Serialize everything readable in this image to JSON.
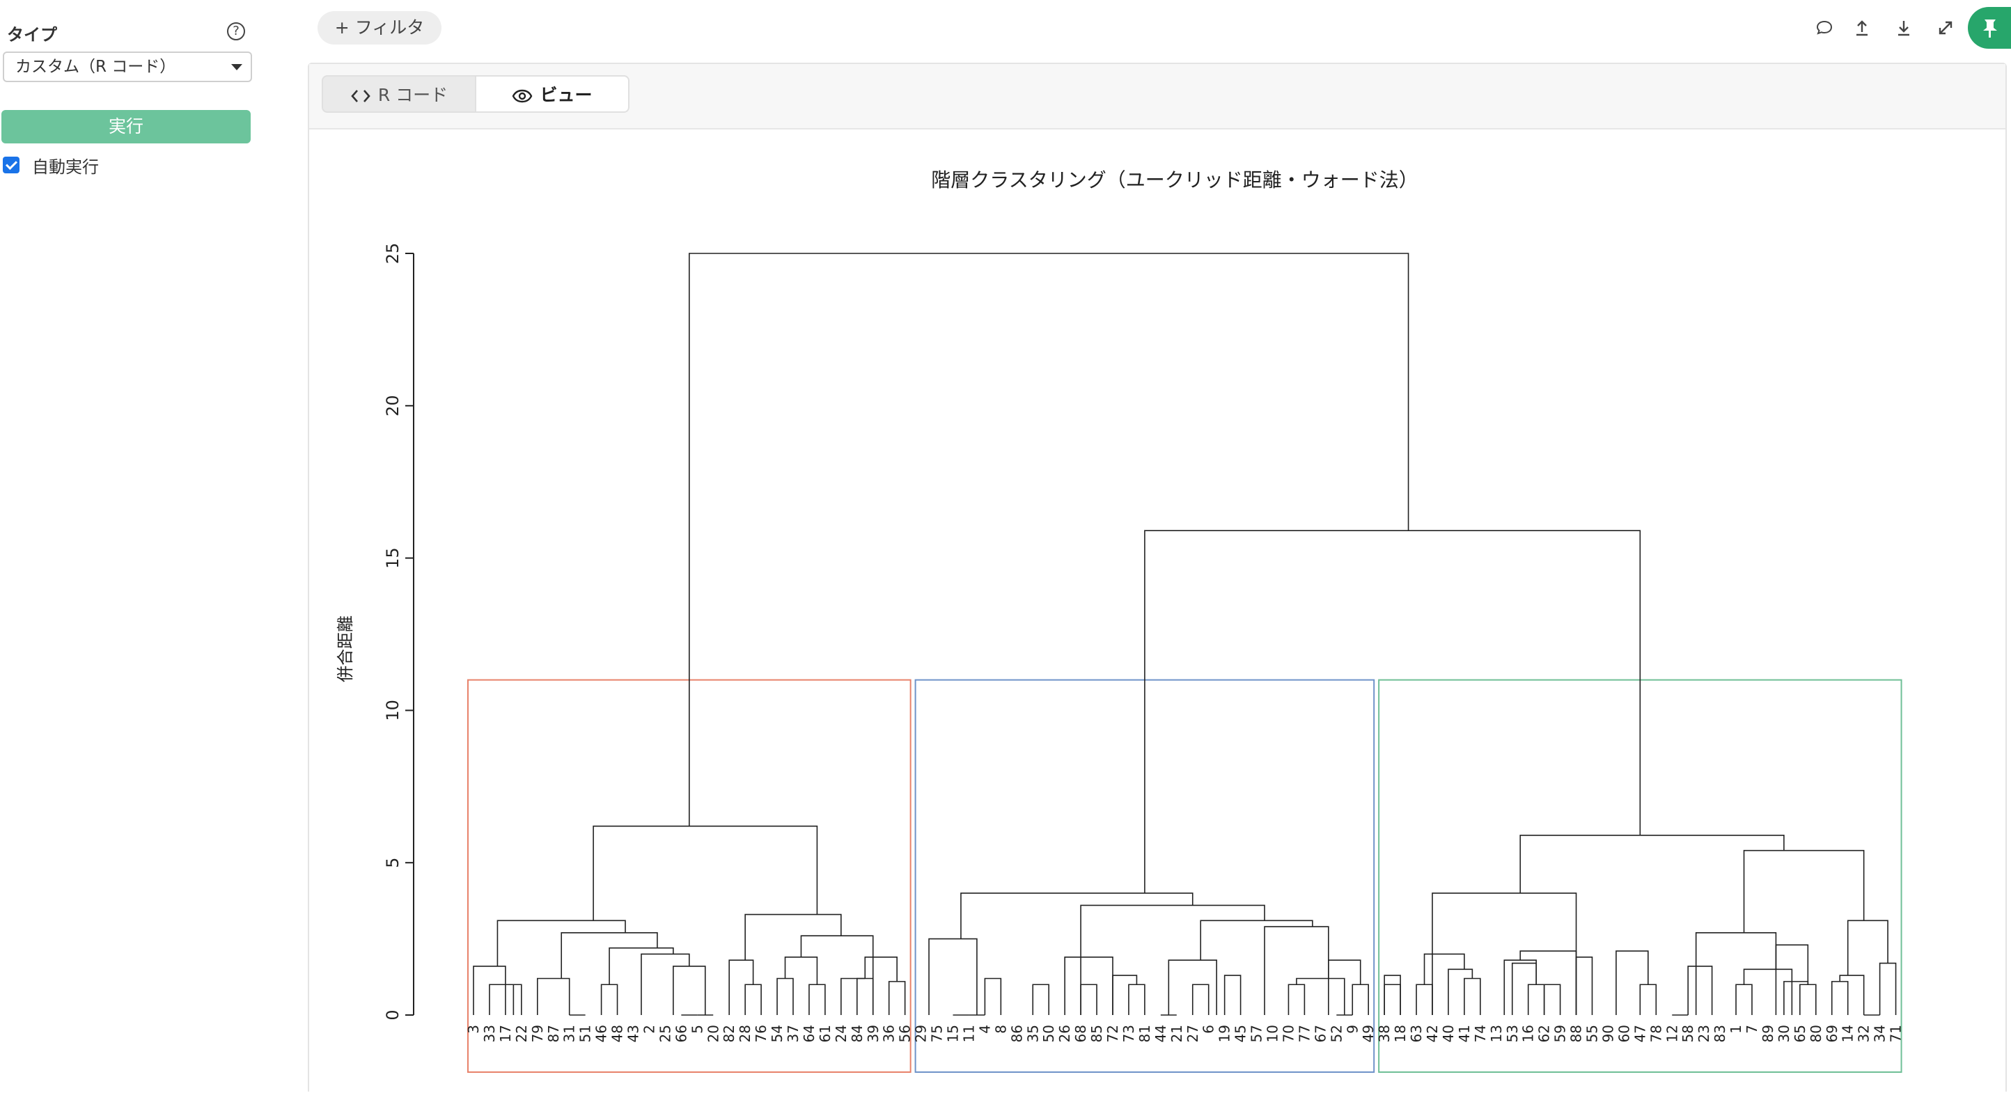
{
  "sidebar": {
    "type_label": "タイプ",
    "select_value": "カスタム（R コード）",
    "run_label": "実行",
    "auto_run_label": "自動実行",
    "auto_run_checked": true
  },
  "toolbar": {
    "filter_label": "+ フィルタ",
    "icons": [
      "comment-icon",
      "upload-icon",
      "download-icon",
      "expand-icon",
      "pin-icon"
    ],
    "accent_color": "#27a66b"
  },
  "tabs": {
    "code_label": "R コード",
    "view_label": "ビュー",
    "active": "view"
  },
  "chart_data": {
    "type": "dendrogram",
    "title": "階層クラスタリング（ユークリッド距離・ウォード法）",
    "ylabel": "併合距離",
    "ylim": [
      0,
      25
    ],
    "yticks": [
      0,
      5,
      10,
      15,
      20,
      25
    ],
    "leaves": [
      "3",
      "33",
      "17",
      "22",
      "79",
      "87",
      "31",
      "51",
      "46",
      "48",
      "43",
      "2",
      "25",
      "66",
      "5",
      "20",
      "82",
      "28",
      "76",
      "54",
      "37",
      "64",
      "61",
      "24",
      "84",
      "39",
      "36",
      "56",
      "29",
      "75",
      "15",
      "11",
      "4",
      "8",
      "86",
      "35",
      "50",
      "26",
      "68",
      "85",
      "72",
      "73",
      "81",
      "44",
      "21",
      "27",
      "6",
      "19",
      "45",
      "57",
      "10",
      "70",
      "77",
      "67",
      "52",
      "9",
      "49",
      "38",
      "18",
      "63",
      "42",
      "40",
      "41",
      "74",
      "13",
      "53",
      "16",
      "62",
      "59",
      "88",
      "55",
      "90",
      "60",
      "47",
      "78",
      "12",
      "58",
      "23",
      "83",
      "1",
      "7",
      "89",
      "30",
      "65",
      "80",
      "69",
      "14",
      "32",
      "34",
      "71"
    ],
    "merges": [
      {
        "height": 25.0,
        "ranges": [
          [
            0,
            27
          ],
          [
            28,
            89
          ]
        ]
      },
      {
        "height": 15.9,
        "ranges": [
          [
            28,
            56
          ],
          [
            57,
            89
          ]
        ]
      },
      {
        "height": 6.2,
        "ranges": [
          [
            0,
            15
          ],
          [
            16,
            27
          ]
        ]
      },
      {
        "height": 5.9,
        "ranges": [
          [
            57,
            74
          ],
          [
            75,
            89
          ]
        ]
      },
      {
        "height": 5.4,
        "ranges": [
          [
            75,
            84
          ],
          [
            85,
            89
          ]
        ]
      },
      {
        "height": 4.0,
        "ranges": [
          [
            28,
            33
          ],
          [
            34,
            56
          ]
        ]
      },
      {
        "height": 4.0,
        "ranges": [
          [
            57,
            63
          ],
          [
            64,
            74
          ]
        ]
      },
      {
        "height": 3.6,
        "ranges": [
          [
            34,
            42
          ],
          [
            43,
            56
          ]
        ]
      },
      {
        "height": 3.3,
        "ranges": [
          [
            16,
            18
          ],
          [
            19,
            27
          ]
        ]
      },
      {
        "height": 3.1,
        "ranges": [
          [
            0,
            3
          ],
          [
            4,
            15
          ]
        ]
      },
      {
        "height": 3.1,
        "ranges": [
          [
            43,
            48
          ],
          [
            49,
            56
          ]
        ]
      },
      {
        "height": 3.1,
        "ranges": [
          [
            85,
            87
          ],
          [
            88,
            89
          ]
        ]
      },
      {
        "height": 2.9,
        "ranges": [
          [
            49,
            50
          ],
          [
            51,
            56
          ]
        ]
      },
      {
        "height": 2.7,
        "ranges": [
          [
            4,
            7
          ],
          [
            8,
            15
          ]
        ]
      },
      {
        "height": 2.7,
        "ranges": [
          [
            75,
            78
          ],
          [
            79,
            84
          ]
        ]
      },
      {
        "height": 2.6,
        "ranges": [
          [
            19,
            22
          ],
          [
            23,
            27
          ]
        ]
      },
      {
        "height": 2.5,
        "ranges": [
          [
            28,
            29
          ],
          [
            30,
            33
          ]
        ]
      },
      {
        "height": 2.3,
        "ranges": [
          [
            81,
            82
          ],
          [
            83,
            84
          ]
        ]
      },
      {
        "height": 2.2,
        "ranges": [
          [
            8,
            9
          ],
          [
            10,
            15
          ]
        ]
      },
      {
        "height": 2.1,
        "ranges": [
          [
            64,
            67
          ],
          [
            68,
            70
          ]
        ]
      },
      {
        "height": 2.1,
        "ranges": [
          [
            71,
            72
          ],
          [
            73,
            74
          ]
        ]
      },
      {
        "height": 2.0,
        "ranges": [
          [
            59,
            60
          ],
          [
            61,
            63
          ]
        ]
      },
      {
        "height": 2.0,
        "ranges": [
          [
            10,
            11
          ],
          [
            12,
            15
          ]
        ]
      },
      {
        "height": 1.9,
        "ranges": [
          [
            19,
            20
          ],
          [
            21,
            22
          ]
        ]
      },
      {
        "height": 1.9,
        "ranges": [
          [
            24,
            25
          ],
          [
            26,
            27
          ]
        ]
      },
      {
        "height": 1.9,
        "ranges": [
          [
            37,
            37
          ],
          [
            38,
            42
          ]
        ]
      },
      {
        "height": 1.9,
        "ranges": [
          [
            69,
            69
          ],
          [
            70,
            70
          ]
        ]
      },
      {
        "height": 1.8,
        "ranges": [
          [
            43,
            44
          ],
          [
            45,
            48
          ]
        ]
      },
      {
        "height": 1.8,
        "ranges": [
          [
            64,
            65
          ],
          [
            66,
            67
          ]
        ]
      },
      {
        "height": 1.8,
        "ranges": [
          [
            16,
            16
          ],
          [
            17,
            18
          ]
        ]
      },
      {
        "height": 1.8,
        "ranges": [
          [
            53,
            54
          ],
          [
            55,
            56
          ]
        ]
      },
      {
        "height": 1.7,
        "ranges": [
          [
            65,
            65
          ],
          [
            66,
            67
          ]
        ]
      },
      {
        "height": 1.7,
        "ranges": [
          [
            89,
            89
          ],
          [
            88,
            88
          ]
        ]
      },
      {
        "height": 1.6,
        "ranges": [
          [
            0,
            0
          ],
          [
            1,
            3
          ]
        ]
      },
      {
        "height": 1.6,
        "ranges": [
          [
            12,
            13
          ],
          [
            14,
            15
          ]
        ]
      },
      {
        "height": 1.6,
        "ranges": [
          [
            77,
            78
          ],
          [
            76,
            76
          ]
        ]
      },
      {
        "height": 1.5,
        "ranges": [
          [
            79,
            80
          ],
          [
            81,
            84
          ]
        ]
      },
      {
        "height": 1.5,
        "ranges": [
          [
            61,
            61
          ],
          [
            62,
            63
          ]
        ]
      },
      {
        "height": 1.3,
        "ranges": [
          [
            40,
            40
          ],
          [
            41,
            42
          ]
        ]
      },
      {
        "height": 1.3,
        "ranges": [
          [
            57,
            57
          ],
          [
            58,
            58
          ]
        ]
      },
      {
        "height": 1.3,
        "ranges": [
          [
            47,
            47
          ],
          [
            48,
            48
          ]
        ]
      },
      {
        "height": 1.3,
        "ranges": [
          [
            85,
            86
          ],
          [
            87,
            87
          ]
        ]
      },
      {
        "height": 1.2,
        "ranges": [
          [
            51,
            52
          ],
          [
            53,
            56
          ]
        ]
      },
      {
        "height": 1.2,
        "ranges": [
          [
            4,
            4
          ],
          [
            5,
            7
          ]
        ]
      },
      {
        "height": 1.2,
        "ranges": [
          [
            19,
            19
          ],
          [
            20,
            20
          ]
        ]
      },
      {
        "height": 1.2,
        "ranges": [
          [
            24,
            24
          ],
          [
            25,
            25
          ]
        ]
      },
      {
        "height": 1.2,
        "ranges": [
          [
            23,
            23
          ],
          [
            24,
            25
          ]
        ]
      },
      {
        "height": 1.2,
        "ranges": [
          [
            32,
            32
          ],
          [
            33,
            33
          ]
        ]
      },
      {
        "height": 1.2,
        "ranges": [
          [
            62,
            62
          ],
          [
            63,
            63
          ]
        ]
      },
      {
        "height": 1.1,
        "ranges": [
          [
            26,
            26
          ],
          [
            27,
            27
          ]
        ]
      },
      {
        "height": 1.1,
        "ranges": [
          [
            82,
            82
          ],
          [
            83,
            84
          ]
        ]
      },
      {
        "height": 1.1,
        "ranges": [
          [
            85,
            85
          ],
          [
            86,
            86
          ]
        ]
      },
      {
        "height": 1.0,
        "ranges": [
          [
            1,
            1
          ],
          [
            2,
            3
          ]
        ]
      },
      {
        "height": 1.0,
        "ranges": [
          [
            2,
            2
          ],
          [
            3,
            3
          ]
        ]
      },
      {
        "height": 1.0,
        "ranges": [
          [
            8,
            8
          ],
          [
            9,
            9
          ]
        ]
      },
      {
        "height": 1.0,
        "ranges": [
          [
            17,
            17
          ],
          [
            18,
            18
          ]
        ]
      },
      {
        "height": 1.0,
        "ranges": [
          [
            21,
            21
          ],
          [
            22,
            22
          ]
        ]
      },
      {
        "height": 1.0,
        "ranges": [
          [
            35,
            35
          ],
          [
            36,
            36
          ]
        ]
      },
      {
        "height": 1.0,
        "ranges": [
          [
            38,
            38
          ],
          [
            39,
            39
          ]
        ]
      },
      {
        "height": 1.0,
        "ranges": [
          [
            41,
            41
          ],
          [
            42,
            42
          ]
        ]
      },
      {
        "height": 1.0,
        "ranges": [
          [
            45,
            45
          ],
          [
            46,
            46
          ]
        ]
      },
      {
        "height": 1.0,
        "ranges": [
          [
            51,
            51
          ],
          [
            52,
            52
          ]
        ]
      },
      {
        "height": 1.0,
        "ranges": [
          [
            55,
            55
          ],
          [
            56,
            56
          ]
        ]
      },
      {
        "height": 1.0,
        "ranges": [
          [
            58,
            58
          ],
          [
            57,
            57
          ]
        ]
      },
      {
        "height": 1.0,
        "ranges": [
          [
            60,
            60
          ],
          [
            59,
            59
          ]
        ]
      },
      {
        "height": 1.0,
        "ranges": [
          [
            66,
            66
          ],
          [
            67,
            67
          ]
        ]
      },
      {
        "height": 1.0,
        "ranges": [
          [
            68,
            68
          ],
          [
            67,
            67
          ]
        ]
      },
      {
        "height": 1.0,
        "ranges": [
          [
            73,
            73
          ],
          [
            74,
            74
          ]
        ]
      },
      {
        "height": 1.0,
        "ranges": [
          [
            79,
            79
          ],
          [
            80,
            80
          ]
        ]
      },
      {
        "height": 1.0,
        "ranges": [
          [
            83,
            83
          ],
          [
            84,
            84
          ]
        ]
      },
      {
        "height": 0.0,
        "ranges": [
          [
            6,
            6
          ],
          [
            7,
            7
          ]
        ]
      },
      {
        "height": 0.0,
        "ranges": [
          [
            13,
            13
          ],
          [
            14,
            14
          ]
        ]
      },
      {
        "height": 0.0,
        "ranges": [
          [
            14,
            14
          ],
          [
            15,
            15
          ]
        ]
      },
      {
        "height": 0.0,
        "ranges": [
          [
            30,
            30
          ],
          [
            31,
            31
          ]
        ]
      },
      {
        "height": 0.0,
        "ranges": [
          [
            31,
            31
          ],
          [
            32,
            32
          ]
        ]
      },
      {
        "height": 0.0,
        "ranges": [
          [
            43,
            43
          ],
          [
            44,
            44
          ]
        ]
      },
      {
        "height": 0.0,
        "ranges": [
          [
            54,
            54
          ],
          [
            55,
            55
          ]
        ]
      },
      {
        "height": 0.0,
        "ranges": [
          [
            75,
            75
          ],
          [
            76,
            76
          ]
        ]
      },
      {
        "height": 0.0,
        "ranges": [
          [
            87,
            87
          ],
          [
            88,
            88
          ]
        ]
      }
    ],
    "cluster_boxes": [
      {
        "from": 0,
        "to": 27,
        "color": "#e8826a"
      },
      {
        "from": 28,
        "to": 56,
        "color": "#6f93c9"
      },
      {
        "from": 57,
        "to": 89,
        "color": "#6fbf96"
      }
    ],
    "cut_height": 11
  }
}
